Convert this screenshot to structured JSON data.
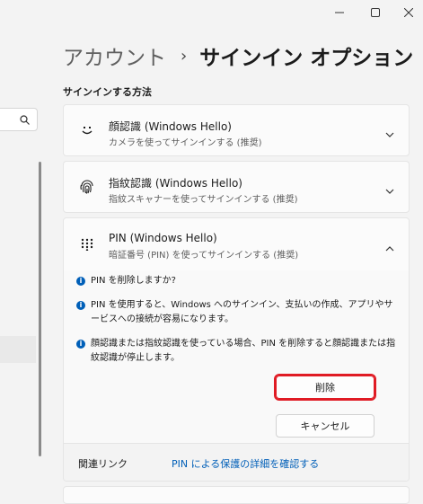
{
  "window": {
    "minimize_glyph": "—",
    "maximize_icon": "maximize-icon",
    "close_icon": "close-icon"
  },
  "breadcrumb": {
    "parent": "アカウント",
    "separator": "›",
    "current": "サインイン オプション"
  },
  "section_title": "サインインする方法",
  "cards": [
    {
      "icon": "face-icon",
      "title": "顔認識 (Windows Hello)",
      "subtitle": "カメラを使ってサインインする (推奨)"
    },
    {
      "icon": "fingerprint-icon",
      "title": "指紋認識 (Windows Hello)",
      "subtitle": "指紋スキャナーを使ってサインインする (推奨)"
    }
  ],
  "pin": {
    "icon": "pin-keypad-icon",
    "title": "PIN (Windows Hello)",
    "subtitle": "暗証番号 (PIN) を使ってサインインする (推奨)",
    "info": [
      "PIN を削除しますか?",
      "PIN を使用すると、Windows へのサインイン、支払いの作成、アプリやサービスへの接続が容易になります。",
      "顔認識または指紋認識を使っている場合、PIN を削除すると顔認識または指紋認識が停止します。"
    ],
    "delete_label": "削除",
    "cancel_label": "キャンセル",
    "related_label": "関連リンク",
    "related_link": "PIN による保護の詳細を確認する"
  },
  "colors": {
    "accent": "#005fb8",
    "highlight_border": "#e01b24",
    "background": "#f3f3f3"
  }
}
